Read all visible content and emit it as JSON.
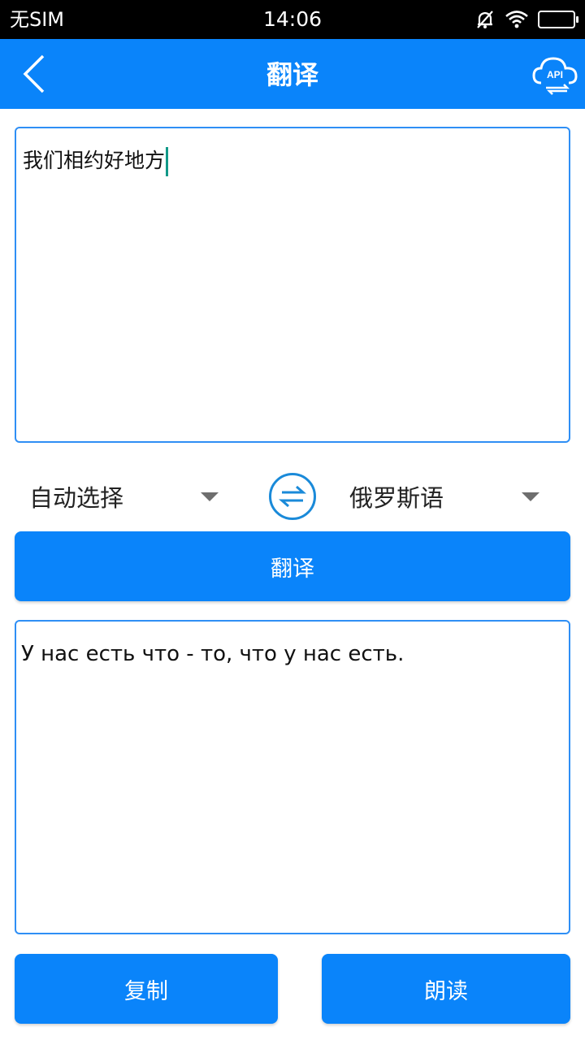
{
  "status_bar": {
    "carrier": "无SIM",
    "time": "14:06",
    "icons": [
      "bell-muted-icon",
      "wifi-icon",
      "battery-icon"
    ]
  },
  "app_bar": {
    "title": "翻译",
    "back_icon": "chevron-left-icon",
    "api_icon": "cloud-api-icon",
    "api_label": "API"
  },
  "source": {
    "text": "我们相约好地方"
  },
  "languages": {
    "source_lang": "自动选择",
    "target_lang": "俄罗斯语",
    "swap_icon": "swap-arrows-icon"
  },
  "translate_button": "翻译",
  "result": {
    "text": "У нас есть что - то, что у нас есть."
  },
  "actions": {
    "copy_label": "复制",
    "read_label": "朗读"
  },
  "colors": {
    "primary": "#0a84fa",
    "border": "#2f8ff5",
    "cursor": "#119988",
    "status_bg": "#000000"
  }
}
